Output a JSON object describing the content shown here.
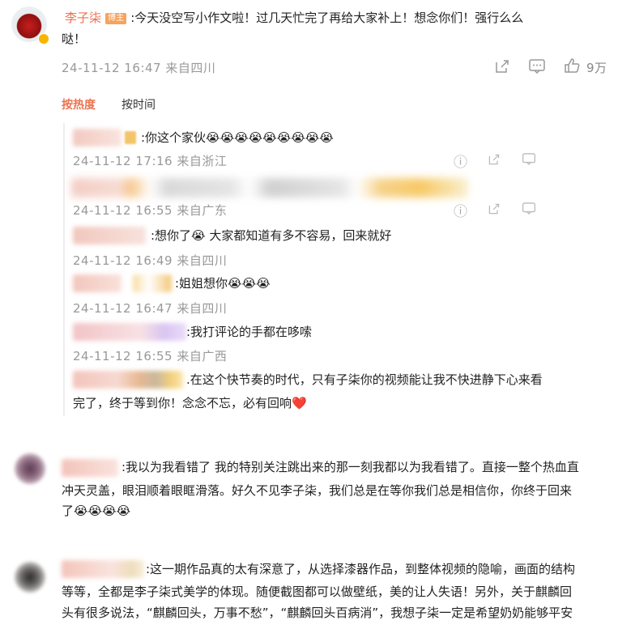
{
  "post": {
    "author": "李子柒",
    "badge": "博主",
    "text_line1": ":今天没空写小作文啦！过几天忙完了再给大家补上！想念你们！强行么么",
    "text_line2": "哒！",
    "meta": "24-11-12 16:47 来自四川",
    "like_count": "9万"
  },
  "tabs": {
    "hot": "按热度",
    "time": "按时间"
  },
  "replies": [
    {
      "text": ":你这个家伙😭😭😭😭😭😭😭😭😭",
      "meta": "24-11-12 17:16 来自浙江"
    },
    {
      "text": "",
      "meta": "24-11-12 16:55 来自广东"
    },
    {
      "text": ":想你了😭 大家都知道有多不容易，回来就好",
      "meta": "24-11-12 16:49 来自四川"
    },
    {
      "text": ":姐姐想你😭😭😭",
      "meta": "24-11-12 16:47 来自四川"
    },
    {
      "text": ":我打评论的手都在哆嗦",
      "meta": "24-11-12 16:55 来自广西"
    },
    {
      "text": ".在这个快节奏的时代，只有子柒你的视频能让我不快进静下心来看",
      "text2": "完了，终于等到你！念念不忘，必有回响❤️"
    }
  ],
  "comments": [
    {
      "line1": ":我以为我看错了 我的特别关注跳出来的那一刻我都以为我看错了。直接一整个热血直",
      "line2": "冲天灵盖，眼泪顺着眼眶滑落。好久不见李子柒，我们总是在等你我们总是相信你，你终于回来",
      "line3": "了😭😭😭😭"
    },
    {
      "line1": ":这一期作品真的太有深意了，从选择漆器作品，到整体视频的隐喻，画面的结构",
      "line2": "等等，全都是李子柒式美学的体现。随便截图都可以做壁纸，美的让人失语！另外，关于麒麟回",
      "line3": "头有很多说法，“麒麟回头，万事不愁”，“麒麟回头百病消”，我想子柒一定是希望奶奶能够平安"
    }
  ],
  "colors": {
    "accent": "#eb7350",
    "meta": "#999999",
    "text": "#222222"
  }
}
